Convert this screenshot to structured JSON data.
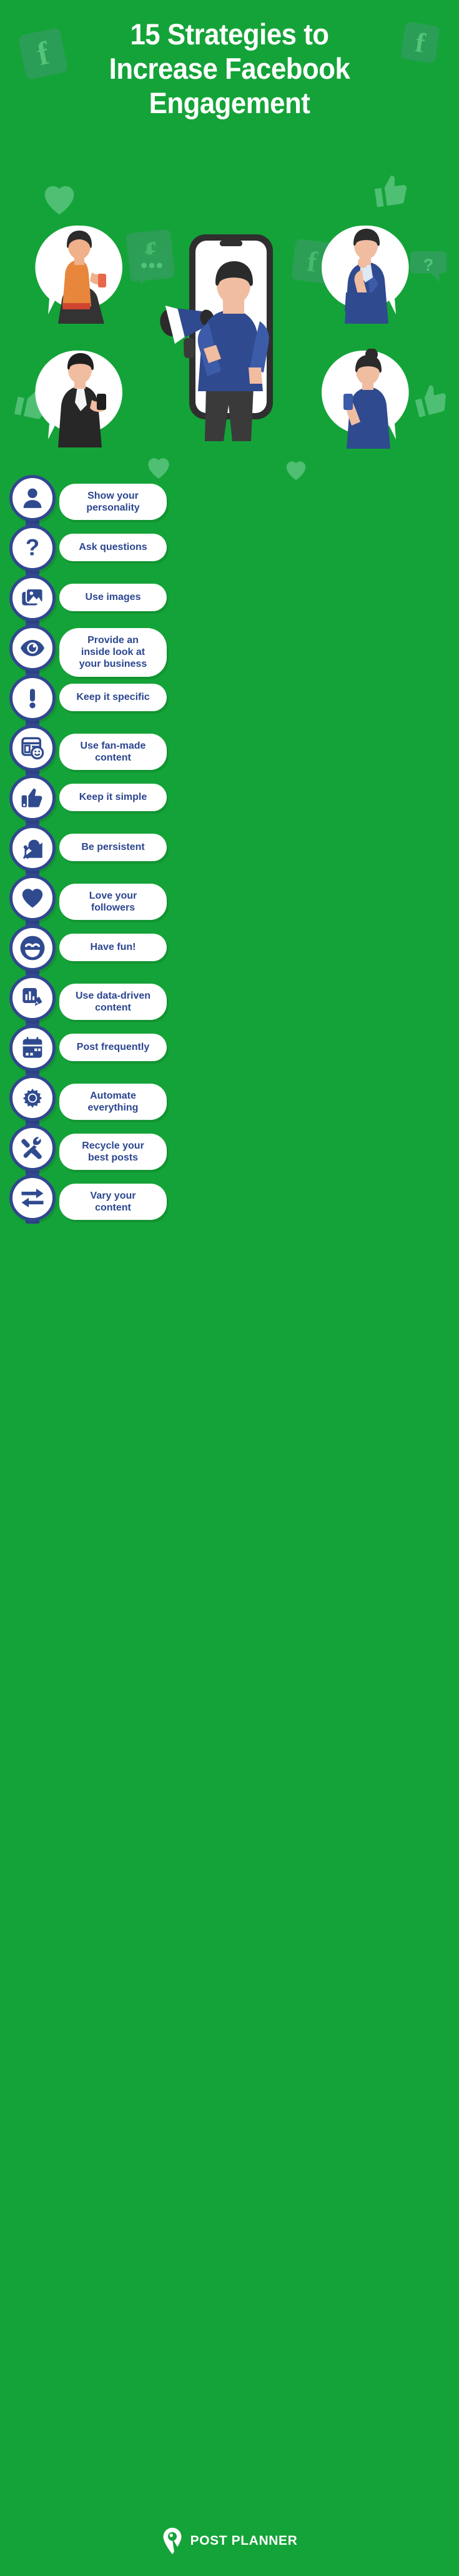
{
  "theme": {
    "background_green": "#14a338",
    "accent_blue": "#31478f",
    "pill_background": "#ffffff",
    "title_color": "#ffffff",
    "deco_green": "#2a9e57"
  },
  "header": {
    "title_line1": "15 Strategies to",
    "title_line2": "Increase Facebook",
    "title_line3": "Engagement",
    "decorations": [
      "facebook-square-icon",
      "facebook-square-icon",
      "heart-icon",
      "thumbs-up-icon",
      "question-bubble-icon",
      "chat-bubble-icon"
    ],
    "illustration": {
      "center": "man-with-megaphone-in-phone",
      "avatars": [
        "woman-with-phone-orange",
        "man-thinking-blue-suit",
        "man-with-phone-black-jacket",
        "woman-with-phone-blue-sweater"
      ]
    }
  },
  "strategies": [
    {
      "index": 1,
      "label": "Show your personality",
      "icon": "user-icon",
      "pill_width": 172,
      "two_line": false
    },
    {
      "index": 2,
      "label": "Ask questions",
      "icon": "question-icon",
      "pill_width": 172,
      "two_line": false
    },
    {
      "index": 3,
      "label": "Use images",
      "icon": "images-icon",
      "pill_width": 172,
      "two_line": false
    },
    {
      "index": 4,
      "label": "Provide an inside look at your business",
      "icon": "eye-icon",
      "pill_width": 172,
      "two_line": true
    },
    {
      "index": 5,
      "label": "Keep it specific",
      "icon": "exclamation-icon",
      "pill_width": 172,
      "two_line": false
    },
    {
      "index": 6,
      "label": "Use fan-made content",
      "icon": "post-smiley-icon",
      "pill_width": 172,
      "two_line": false
    },
    {
      "index": 7,
      "label": "Keep it simple",
      "icon": "thumbs-up-icon",
      "pill_width": 172,
      "two_line": false
    },
    {
      "index": 8,
      "label": "Be persistent",
      "icon": "boulder-push-icon",
      "pill_width": 172,
      "two_line": false
    },
    {
      "index": 9,
      "label": "Love your followers",
      "icon": "heart-icon",
      "pill_width": 172,
      "two_line": false
    },
    {
      "index": 10,
      "label": "Have fun!",
      "icon": "smiley-icon",
      "pill_width": 172,
      "two_line": false
    },
    {
      "index": 11,
      "label": "Use data-driven content",
      "icon": "chart-pen-icon",
      "pill_width": 172,
      "two_line": false
    },
    {
      "index": 12,
      "label": "Post frequently",
      "icon": "calendar-icon",
      "pill_width": 172,
      "two_line": false
    },
    {
      "index": 13,
      "label": "Automate everything",
      "icon": "gear-icon",
      "pill_width": 172,
      "two_line": false
    },
    {
      "index": 14,
      "label": "Recycle your best posts",
      "icon": "tools-icon",
      "pill_width": 172,
      "two_line": false
    },
    {
      "index": 15,
      "label": "Vary your content",
      "icon": "swap-arrows-icon",
      "pill_width": 172,
      "two_line": false
    }
  ],
  "footer": {
    "brand": "POST PLANNER",
    "logo_icon": "location-pin-icon"
  }
}
